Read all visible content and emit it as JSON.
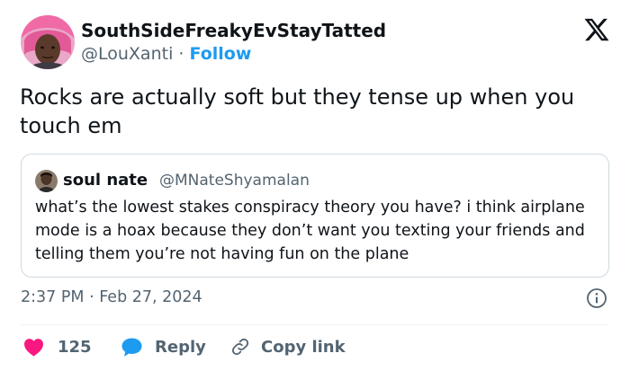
{
  "author": {
    "display_name": "SouthSideFreakyEvStayTatted",
    "handle": "@LouXanti",
    "separator": "·",
    "follow_label": "Follow"
  },
  "tweet": {
    "text": "Rocks are actually soft but they tense up when you touch em",
    "timestamp": "2:37 PM · Feb 27, 2024"
  },
  "quoted_tweet": {
    "display_name": "soul nate",
    "handle": "@MNateShyamalan",
    "text": "what’s the lowest stakes conspiracy theory you have? i think airplane mode is a hoax because they don’t want you texting your friends and telling them you’re not having fun on the plane"
  },
  "actions": {
    "like_count": "125",
    "reply_label": "Reply",
    "copy_link_label": "Copy link"
  },
  "icons": {
    "brand": "x-logo-icon",
    "info": "info-icon",
    "like": "heart-icon",
    "reply": "speech-bubble-icon",
    "copy": "link-icon"
  },
  "colors": {
    "accent": "#1d9bf0",
    "like": "#f91880",
    "text_primary": "#0f1419",
    "text_secondary": "#536471",
    "border": "#cfd9de"
  }
}
